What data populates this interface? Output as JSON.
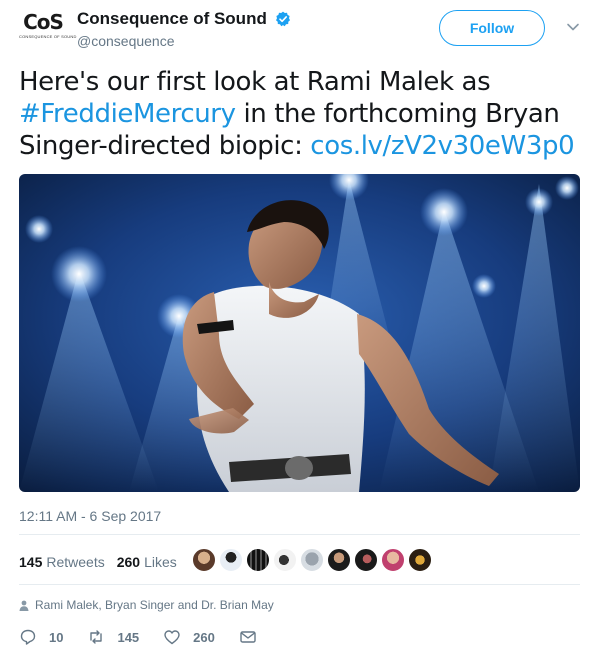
{
  "account": {
    "logo_mark": "CoS",
    "logo_sub": "CONSEQUENCE OF SOUND",
    "display_name": "Consequence of Sound",
    "handle": "@consequence",
    "verified": true
  },
  "follow_label": "Follow",
  "tweet": {
    "text_before": "Here's our first look at Rami Malek as ",
    "hashtag": "#FreddieMercury",
    "text_middle": " in the forthcoming Bryan Singer-directed biopic: ",
    "link": "cos.lv/zV2v30eW3p0"
  },
  "timestamp": "12:11 AM - 6 Sep 2017",
  "stats": {
    "retweets_count": "145",
    "retweets_label": "Retweets",
    "likes_count": "260",
    "likes_label": "Likes"
  },
  "context_line": "Rami Malek, Bryan Singer and Dr. Brian May",
  "actions": {
    "replies": "10",
    "retweets": "145",
    "likes": "260"
  },
  "colors": {
    "link": "#1b95e0",
    "follow": "#1da1f2",
    "muted": "#657786"
  }
}
